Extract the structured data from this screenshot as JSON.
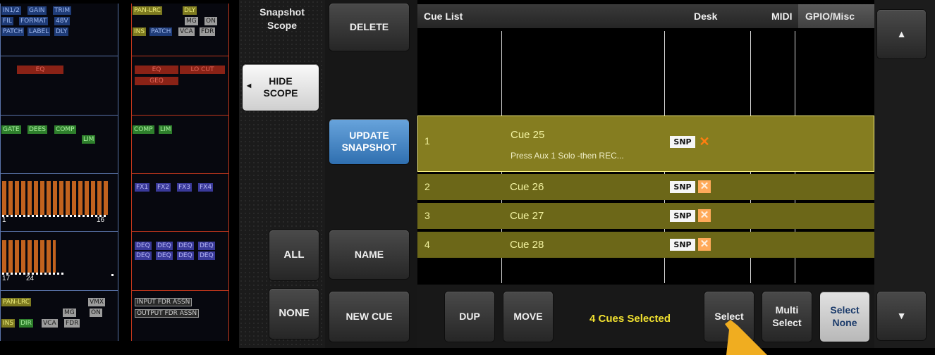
{
  "scope_input": {
    "row1": [
      "IN1/2",
      "GAIN",
      "TRIM"
    ],
    "row2": [
      "FIL",
      "FORMAT",
      "48V"
    ],
    "row3": [
      "PATCH",
      "LABEL",
      "DLY"
    ],
    "eq": "EQ",
    "dyn": [
      "GATE",
      "DEES",
      "COMP",
      "LIM"
    ],
    "meter_a_from": "1",
    "meter_a_to": "16",
    "meter_b_from": "17",
    "meter_b_to": "24",
    "bot1": [
      "PAN-LRC",
      "VMX"
    ],
    "bot2": [
      "MG",
      "ON"
    ],
    "bot3": [
      "INS",
      "DIR",
      "VCA",
      "FDR"
    ]
  },
  "scope_output": {
    "row1": [
      "PAN-LRC",
      "DLY"
    ],
    "row2": [
      "MG",
      "ON"
    ],
    "row3": [
      "INS",
      "PATCH",
      "VCA",
      "FDR"
    ],
    "eq": [
      "EQ",
      "LO CUT",
      "GEQ"
    ],
    "dyn": [
      "COMP",
      "LIM"
    ],
    "fx": [
      "FX1",
      "FX2",
      "FX3",
      "FX4"
    ],
    "deq1": [
      "DEQ",
      "DEQ",
      "DEQ",
      "DEQ"
    ],
    "deq2": [
      "DEQ",
      "DEQ",
      "DEQ",
      "DEQ"
    ],
    "assn1": "INPUT FDR ASSN",
    "assn2": "OUTPUT FDR ASSN"
  },
  "snapshot_scope": {
    "title_line1": "Snapshot",
    "title_line2": "Scope",
    "hide_line1": "HIDE",
    "hide_line2": "SCOPE",
    "all": "ALL",
    "none": "NONE"
  },
  "actions": {
    "delete": "DELETE",
    "update_line1": "UPDATE",
    "update_line2": "SNAPSHOT",
    "name": "NAME",
    "new_cue": "NEW CUE"
  },
  "cue_list": {
    "header": "Cue List",
    "col_desk": "Desk",
    "col_midi": "MIDI",
    "col_gpio": "GPIO/Misc",
    "snp": "SNP",
    "x": "✕",
    "cues": [
      {
        "num": "1",
        "name": "Cue 25",
        "note": "Press Aux 1 Solo -then REC..."
      },
      {
        "num": "2",
        "name": "Cue 26",
        "note": ""
      },
      {
        "num": "3",
        "name": "Cue 27",
        "note": ""
      },
      {
        "num": "4",
        "name": "Cue 28",
        "note": ""
      }
    ]
  },
  "bottom": {
    "dup": "DUP",
    "move": "MOVE",
    "status": "4 Cues Selected",
    "select": "Select",
    "multi_line1": "Multi",
    "multi_line2": "Select",
    "selnone_line1": "Select",
    "selnone_line2": "None"
  },
  "scroll": {
    "up_icon": "▲",
    "down_icon": "▼"
  }
}
